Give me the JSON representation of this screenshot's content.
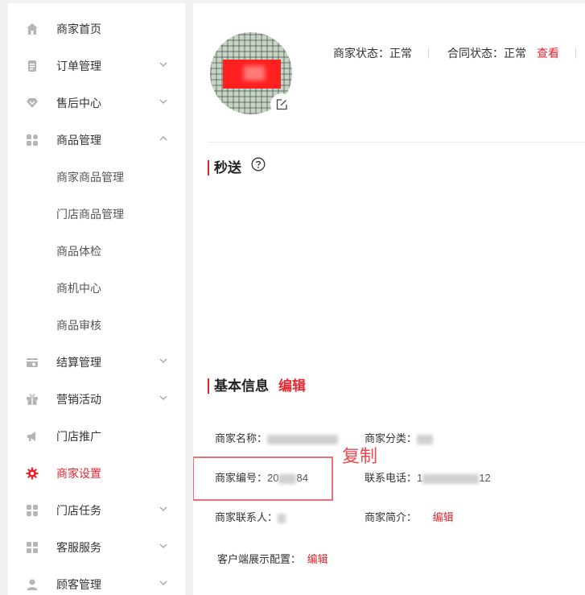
{
  "sidebar": {
    "items": [
      {
        "label": "商家首页",
        "icon": "home-icon"
      },
      {
        "label": "订单管理",
        "icon": "order-icon"
      },
      {
        "label": "售后中心",
        "icon": "after-sales-icon"
      },
      {
        "label": "商品管理",
        "icon": "grid-icon"
      },
      {
        "label": "商家商品管理"
      },
      {
        "label": "门店商品管理"
      },
      {
        "label": "商品体检"
      },
      {
        "label": "商机中心"
      },
      {
        "label": "商品审核"
      },
      {
        "label": "结算管理",
        "icon": "settlement-icon"
      },
      {
        "label": "营销活动",
        "icon": "gift-icon"
      },
      {
        "label": "门店推广",
        "icon": "megaphone-icon"
      },
      {
        "label": "商家设置",
        "icon": "gear-icon"
      },
      {
        "label": "门店任务",
        "icon": "grid-icon"
      },
      {
        "label": "客服服务",
        "icon": "grid-icon"
      },
      {
        "label": "顾客管理",
        "icon": "user-icon"
      }
    ],
    "active_color": "#e8262e"
  },
  "header": {
    "merchant_status_label": "商家状态：",
    "merchant_status_value": "正常",
    "contract_status_label": "合同状态：",
    "contract_status_value": "正常",
    "view_link": "查看"
  },
  "sections": {
    "miaosong_title": "秒送",
    "basic_info_title": "基本信息",
    "edit_label": "编辑"
  },
  "basic_info": {
    "name_label": "商家名称：",
    "category_label": "商家分类：",
    "id_label": "商家编号：",
    "id_value_start": "20",
    "id_value_end": "84",
    "phone_label": "联系电话：",
    "phone_value_start": "1",
    "phone_value_end": "12",
    "contact_label": "商家联系人：",
    "intro_label": "商家简介：",
    "intro_edit": "编辑",
    "client_config_label": "客户端展示配置：",
    "client_config_edit": "编辑"
  },
  "annotation": {
    "copy_text": "复制",
    "color": "#f0474f"
  }
}
